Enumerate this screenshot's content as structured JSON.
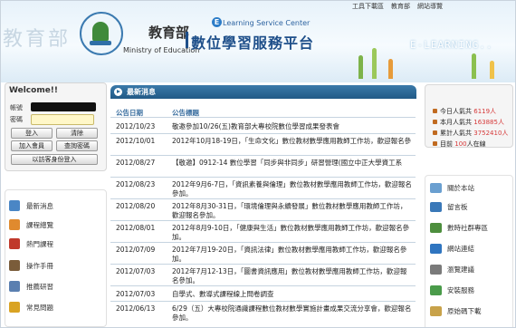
{
  "header": {
    "watermark": "教育部",
    "brand_zh": "教育部",
    "brand_en": "Ministry of Education",
    "service_center": "Learning Service Center",
    "service_center_letter": "E",
    "platform": "數位學習服務平台",
    "elearning": "E-LEARNING..",
    "top_links": [
      "工具下載區",
      "教育部",
      "網站導覽"
    ]
  },
  "login": {
    "welcome": "Welcome!!",
    "account_label": "帳號",
    "password_label": "密碼",
    "buttons": [
      "登入",
      "清除",
      "加入會員",
      "查詢密碼",
      "以訪客身份登入"
    ]
  },
  "left_menu": {
    "items": [
      {
        "label": "最新消息",
        "icon": "news-icon",
        "color": "#4a86c5"
      },
      {
        "label": "課程總覽",
        "icon": "course-icon",
        "color": "#e08a2e"
      },
      {
        "label": "熱門課程",
        "icon": "hot-course-icon",
        "color": "#c0392b"
      },
      {
        "label": "操作手冊",
        "icon": "manual-icon",
        "color": "#7a5c3a"
      },
      {
        "label": "推薦研習",
        "icon": "recommend-icon",
        "color": "#5a7fb0"
      },
      {
        "label": "常見問題",
        "icon": "faq-icon",
        "color": "#d9a323"
      }
    ]
  },
  "news": {
    "title": "最新消息",
    "col_date": "公告日期",
    "col_title": "公告標題",
    "rows": [
      {
        "date": "2012/10/23",
        "title": "敬邀參加10/26(五)教育部大專校院數位學習成果發表會"
      },
      {
        "date": "2012/10/01",
        "title": "2012年10月18-19日，「生命文化」數位教材數學應用教師工作坊，歡迎報名參"
      },
      {
        "date": "2012/08/27",
        "title": "【敬邀】0912-14 數位學習「同步與非同步」研習營理(國立中正大學資工系"
      },
      {
        "date": "2012/08/23",
        "title": "2012年9月6-7日，「資訊素養與倫理」數位教材數學應用教師工作坊，歡迎報名參加。"
      },
      {
        "date": "2012/08/20",
        "title": "2012年8月30-31日，「環境倫理與永續發展」數位教材數學應用教師工作坊，歡迎報名參加。"
      },
      {
        "date": "2012/08/01",
        "title": "2012年8月9-10日，「健康與生活」數位教材數學應用教師工作坊，歡迎報名參加。"
      },
      {
        "date": "2012/07/09",
        "title": "2012年7月19-20日，「資訊法律」數位教材數學應用教師工作坊，歡迎報名參加。"
      },
      {
        "date": "2012/07/03",
        "title": "2012年7月12-13日，「圖書資訊應用」數位教材數學應用教師工作坊，歡迎報名參加。"
      },
      {
        "date": "2012/07/03",
        "title": "自學式、數導式課程線上問卷調查"
      },
      {
        "date": "2012/06/13",
        "title": "6/29（五）大專校院通識課程數位教材數學實施計畫成果交流分享會，歡迎報名參加。"
      }
    ]
  },
  "stats": {
    "today_label": "今日人氣共",
    "today": "6119人",
    "month_label": "本月人氣共",
    "month": "163885人",
    "total_label": "累計人氣共",
    "total": "3752410人",
    "online_label": "目前",
    "online": "100",
    "online_suffix": "人在線"
  },
  "right_menu": {
    "items": [
      {
        "label": "關於本站",
        "icon": "about-icon",
        "color": "#6a9fd0"
      },
      {
        "label": "留言板",
        "icon": "message-board-icon",
        "color": "#3a78b8"
      },
      {
        "label": "數時社群專區",
        "icon": "community-icon",
        "color": "#4d8e3d"
      },
      {
        "label": "網站連結",
        "icon": "link-icon",
        "color": "#2f75c0"
      },
      {
        "label": "瀏覽建議",
        "icon": "browse-tip-icon",
        "color": "#7a7a7a"
      },
      {
        "label": "安裝服務",
        "icon": "install-icon",
        "color": "#4a9b4a"
      },
      {
        "label": "原始碼下載",
        "icon": "download-icon",
        "color": "#c8a24a"
      }
    ]
  }
}
